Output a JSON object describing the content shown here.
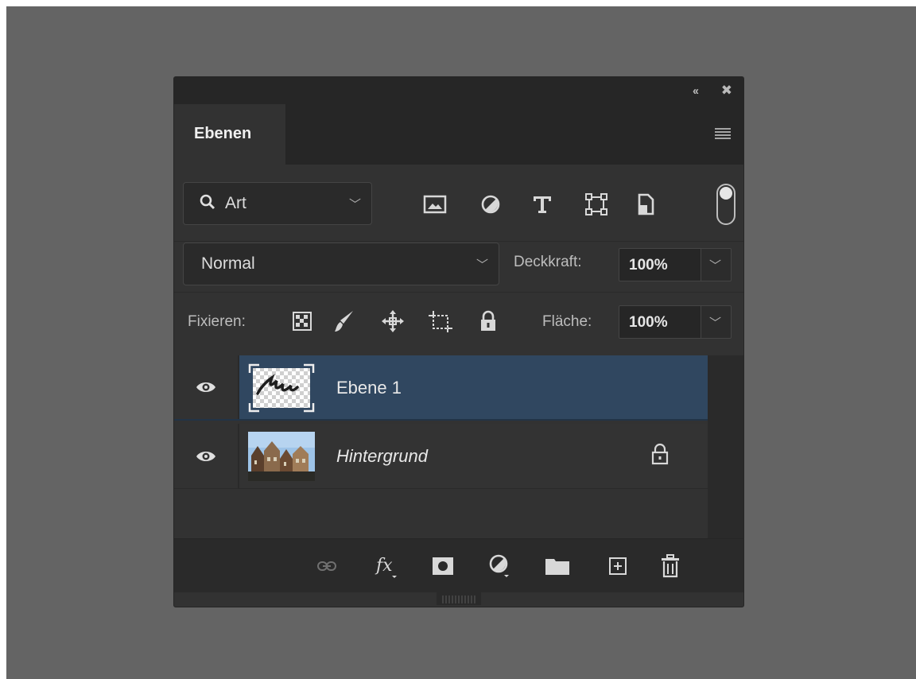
{
  "panel": {
    "tab_label": "Ebenen"
  },
  "filter": {
    "kind_label": "Art",
    "icons": [
      "pixel-filter-icon",
      "adjustment-filter-icon",
      "type-filter-icon",
      "shape-filter-icon",
      "smart-object-filter-icon"
    ]
  },
  "blend": {
    "mode": "Normal",
    "opacity_label": "Deckkraft:",
    "opacity_value": "100%"
  },
  "lock": {
    "label": "Fixieren:",
    "fill_label": "Fläche:",
    "fill_value": "100%"
  },
  "layers": [
    {
      "name": "Ebene 1",
      "selected": true,
      "locked": false
    },
    {
      "name": "Hintergrund",
      "selected": false,
      "locked": true
    }
  ],
  "colors": {
    "panel_bg": "#323232",
    "selected_layer": "#304760",
    "text": "#e8e8e8"
  }
}
